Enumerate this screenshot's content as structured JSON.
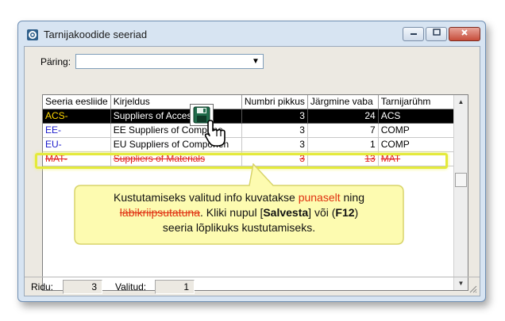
{
  "window": {
    "title": "Tarnijakoodide seeriad",
    "minimize_icon": "minimize-icon",
    "maximize_icon": "maximize-icon",
    "close_icon": "close-icon"
  },
  "query": {
    "label": "Päring:",
    "value": ""
  },
  "grid": {
    "columns": [
      "Seeria eesliide",
      "Kirjeldus",
      "Numbri pikkus",
      "Järgmine vaba",
      "Tarnijarühm"
    ],
    "rows": [
      {
        "prefix": "ACS-",
        "description": "Suppliers of Access",
        "length": "3",
        "next": "24",
        "group": "ACS",
        "state": "selected"
      },
      {
        "prefix": "EE-",
        "description": "EE Suppliers of Compone",
        "length": "3",
        "next": "7",
        "group": "COMP",
        "state": "normal"
      },
      {
        "prefix": "EU-",
        "description": "EU Suppliers of Componen",
        "length": "3",
        "next": "1",
        "group": "COMP",
        "state": "normal"
      },
      {
        "prefix": "MAT-",
        "description": "Suppliers of Materials",
        "length": "3",
        "next": "13",
        "group": "MAT",
        "state": "deleted"
      }
    ]
  },
  "callout": {
    "part1": "Kustutamiseks valitud info kuvatakse ",
    "red_word": "punaselt",
    "part2": " ning ",
    "strike_word": "läbikriipsutatuna",
    "part3": ". Kliki nupul [",
    "save_word": "Salvesta",
    "part4": "] või (",
    "key_word": "F12",
    "part5": ")",
    "line3": "seeria lõplikuks kustutamiseks."
  },
  "status": {
    "rows_label": "Ridu:",
    "rows_value": "3",
    "selected_label": "Valitud:",
    "selected_value": "1"
  },
  "colors": {
    "highlight": "#e4ea3a",
    "callout_fill": "#fdfbb0",
    "deleted_text": "#e02020",
    "selected_row": "#000000",
    "prefix_blue": "#1a1acb"
  }
}
